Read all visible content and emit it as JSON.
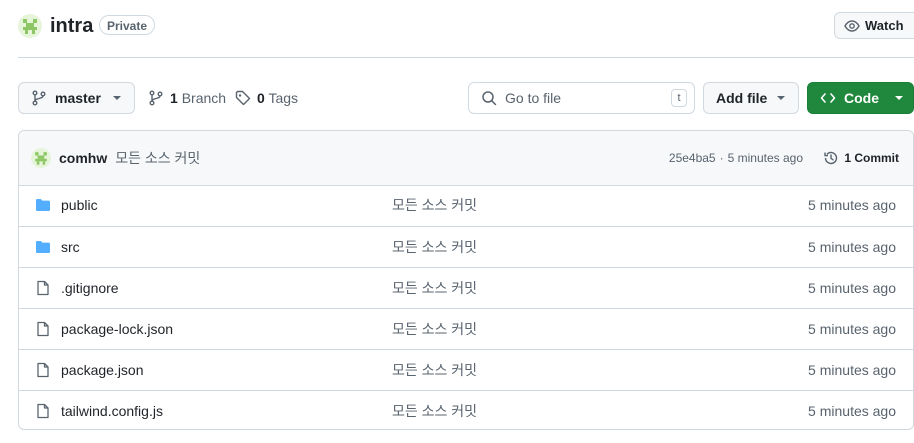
{
  "repo": {
    "name": "intra",
    "visibility": "Private",
    "watch_label": "Watch"
  },
  "toolbar": {
    "branch": "master",
    "branch_count": "1",
    "branch_label": "Branch",
    "tag_count": "0",
    "tag_label": "Tags",
    "search_placeholder": "Go to file",
    "search_shortcut": "t",
    "add_file_label": "Add file",
    "code_label": "Code",
    "accent_color": "#1f883d"
  },
  "commit": {
    "author": "comhw",
    "message": "모든 소스 커밋",
    "sha": "25e4ba5",
    "separator": "·",
    "time": "5 minutes ago",
    "count_label": "1 Commit"
  },
  "files": [
    {
      "name": "public",
      "type": "folder",
      "message": "모든 소스 커밋",
      "time": "5 minutes ago"
    },
    {
      "name": "src",
      "type": "folder",
      "message": "모든 소스 커밋",
      "time": "5 minutes ago"
    },
    {
      "name": ".gitignore",
      "type": "file",
      "message": "모든 소스 커밋",
      "time": "5 minutes ago"
    },
    {
      "name": "package-lock.json",
      "type": "file",
      "message": "모든 소스 커밋",
      "time": "5 minutes ago"
    },
    {
      "name": "package.json",
      "type": "file",
      "message": "모든 소스 커밋",
      "time": "5 minutes ago"
    },
    {
      "name": "tailwind.config.js",
      "type": "file",
      "message": "모든 소스 커밋",
      "time": "5 minutes ago"
    }
  ]
}
